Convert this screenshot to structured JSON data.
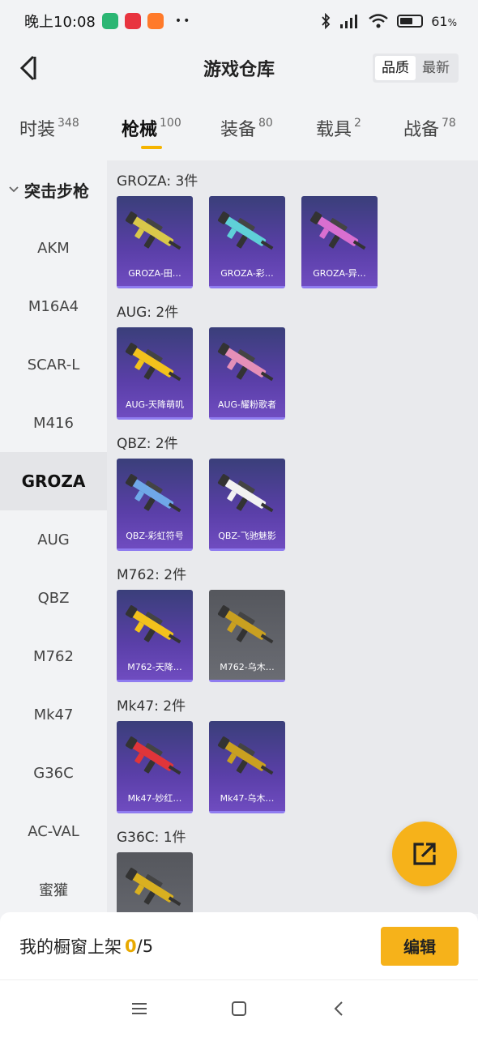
{
  "status": {
    "time": "晚上10:08",
    "battery": "61",
    "battery_unit": "%",
    "battery_level": 0.61,
    "app1_color": "#2bb673",
    "app2_color": "#e8343f",
    "app3_color": "#ff7a2a"
  },
  "header": {
    "title": "游戏仓库",
    "sort_quality": "品质",
    "sort_newest": "最新",
    "active_sort": "品质"
  },
  "tabs": [
    {
      "label": "时装",
      "count": "348"
    },
    {
      "label": "枪械",
      "count": "100",
      "active": true
    },
    {
      "label": "装备",
      "count": "80"
    },
    {
      "label": "载具",
      "count": "2"
    },
    {
      "label": "战备",
      "count": "78"
    }
  ],
  "sidebar": {
    "header": "突击步枪",
    "items": [
      "AKM",
      "M16A4",
      "SCAR-L",
      "M416",
      "GROZA",
      "AUG",
      "QBZ",
      "M762",
      "Mk47",
      "G36C",
      "AC-VAL",
      "蜜獾"
    ],
    "active": "GROZA"
  },
  "groups": [
    {
      "title": "GROZA: 3件",
      "items": [
        {
          "label": "GROZA-田…",
          "icon": "groza-yellow-skin-icon",
          "accent": "#d9c84a"
        },
        {
          "label": "GROZA-彩…",
          "icon": "groza-rainbow-skin-icon",
          "accent": "#5fd0d8"
        },
        {
          "label": "GROZA-异…",
          "icon": "groza-purple-skin-icon",
          "accent": "#d96fd0"
        }
      ]
    },
    {
      "title": "AUG: 2件",
      "items": [
        {
          "label": "AUG-天降萌叽",
          "icon": "aug-yellow-skin-icon",
          "accent": "#f2c21c"
        },
        {
          "label": "AUG-耀粉歌者",
          "icon": "aug-pink-skin-icon",
          "accent": "#e58fb8"
        }
      ]
    },
    {
      "title": "QBZ: 2件",
      "items": [
        {
          "label": "QBZ-彩虹符号",
          "icon": "qbz-rainbow-skin-icon",
          "accent": "#6fa8e8"
        },
        {
          "label": "QBZ-飞驰魅影",
          "icon": "qbz-white-skin-icon",
          "accent": "#f2f2f2"
        }
      ]
    },
    {
      "title": "M762: 2件",
      "items": [
        {
          "label": "M762-天降…",
          "icon": "m762-yellow-skin-icon",
          "accent": "#f2c21c"
        },
        {
          "label": "M762-乌木…",
          "icon": "m762-ebony-skin-icon",
          "accent": "#c9a020",
          "grey": true
        }
      ]
    },
    {
      "title": "Mk47: 2件",
      "items": [
        {
          "label": "Mk47-妙红…",
          "icon": "mk47-red-skin-icon",
          "accent": "#e0353a"
        },
        {
          "label": "Mk47-乌木…",
          "icon": "mk47-ebony-skin-icon",
          "accent": "#c9a020"
        }
      ]
    },
    {
      "title": "G36C: 1件",
      "items": [
        {
          "label": "",
          "icon": "g36c-gold-skin-icon",
          "accent": "#d9b020",
          "grey": true
        }
      ]
    }
  ],
  "shelf": {
    "label": "我的橱窗上架",
    "count": "0",
    "total": "/5"
  },
  "edit_button": "编辑"
}
